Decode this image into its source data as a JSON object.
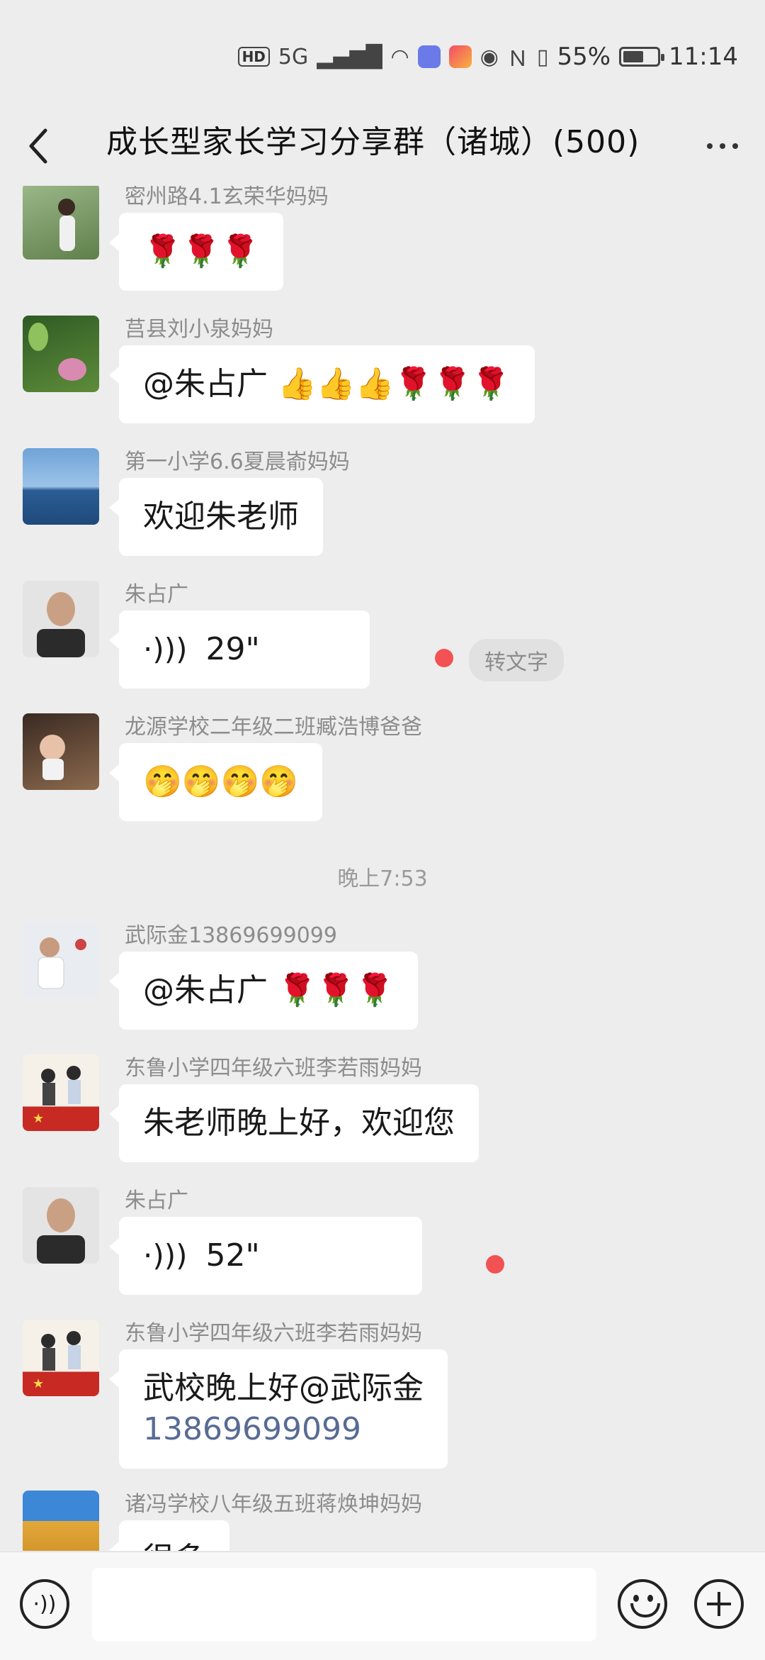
{
  "status_bar": {
    "hd": "HD",
    "network": "5G",
    "battery_percent": "55%",
    "battery_level": 0.55,
    "time": "11:14"
  },
  "nav": {
    "title": "成长型家长学习分享群（诸城）(500)"
  },
  "messages": [
    {
      "sender": "密州路4.1玄荣华妈妈",
      "text": "🌹🌹🌹",
      "avatar_color": "#6f8f5a"
    },
    {
      "sender": "莒县刘小泉妈妈",
      "text": "@朱占广 👍👍👍🌹🌹🌹",
      "avatar_color": "#3f6b2c"
    },
    {
      "sender": "第一小学6.6夏晨嵛妈妈",
      "text": "欢迎朱老师",
      "avatar_color": "#3b6fb0"
    },
    {
      "sender": "朱占广",
      "voice": "29\"",
      "avatar_color": "#d8d8d8",
      "convert": "转文字"
    },
    {
      "sender": "龙源学校二年级二班臧浩博爸爸",
      "text": "🤭🤭🤭🤭",
      "avatar_color": "#7a5238"
    },
    {
      "time_separator": "晚上7:53"
    },
    {
      "sender": "武际金13869699099",
      "text": "@朱占广 🌹🌹🌹",
      "avatar_color": "#dfe4ea"
    },
    {
      "sender": "东鲁小学四年级六班李若雨妈妈",
      "text": "朱老师晚上好，欢迎您",
      "avatar_color": "#c23a33"
    },
    {
      "sender": "朱占广",
      "voice": "52\"",
      "avatar_color": "#d8d8d8"
    },
    {
      "sender": "东鲁小学四年级六班李若雨妈妈",
      "text_line1": "武校晚上好@武际金",
      "text_line2": "13869699099",
      "avatar_color": "#c23a33"
    },
    {
      "sender": "诸冯学校八年级五班蒋焕坤妈妈",
      "text": "很多",
      "avatar_color": "#d9a63a"
    }
  ],
  "colors": {
    "background": "#ededed",
    "bubble": "#ffffff",
    "unread_dot": "#f25254",
    "link": "#576b95"
  }
}
